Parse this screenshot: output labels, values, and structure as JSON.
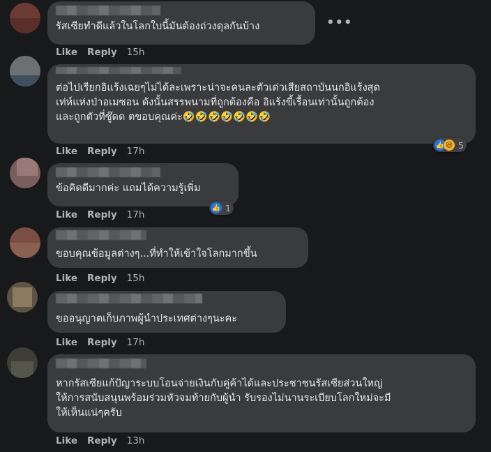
{
  "actions": {
    "like": "Like",
    "reply": "Reply"
  },
  "more_glyph": "•••",
  "comments": [
    {
      "text": "รัสเซียทำดีแล้วในโลกใบนี้มันต้องถ่วงดุลกันบ้าง",
      "time": "15h",
      "avatar_color": "#6b3a32"
    },
    {
      "text": "ต่อไปเรียกอิแร้งเฉยๆไม่ได้ละเพราะน่าจะคนละตัวเด่วเสียสถาบันนกอิแร้งสุด\nเท่ห์แห่งป่าอเมซอน ดังนั้นสรรพนามที่ถูกต้องคือ อิแร้งขี้เรื้อนเท่านั้นถูกต้อง\nและถูกตัวที่ซู๊ดด ตขอบคุณค่ะ🤣🤣🤣🤣🤣🤣🤣",
      "time": "17h",
      "reaction_count": "5",
      "avatar_color": "#7f8182"
    },
    {
      "text": "ข้อคิดดีมากค่ะ แถมได้ความรู้เพิ่ม",
      "time": "17h",
      "reaction_count": "1",
      "avatar_color": "#8a6a68"
    },
    {
      "text": "ขอบคุณข้อมูลต่างๆ...ที่ทำให้เข้าใจโลกมากขึ้น",
      "time": "15h",
      "avatar_color": "#8a5a4a"
    },
    {
      "text": "ขออนุญาตเก็บภาพผู้นำประเทศต่างๆนะคะ",
      "time": "17h",
      "avatar_color": "#6a5a48"
    },
    {
      "text": "หากรัสเซียแก้ปัญาระบบโอนจ่ายเงินกับคู่ค้าได้และประชาชนรัสเซียส่วนใหญ่\nให้การสนับสนุนพร้อมร่วมหัวจมท้ายกับผู้นำ รับรองไม่นานระเบียบโลกใหม่จะมี\nให้เห็นแน่ๆครับ",
      "time": "13h",
      "avatar_color": "#4a4a40"
    }
  ]
}
